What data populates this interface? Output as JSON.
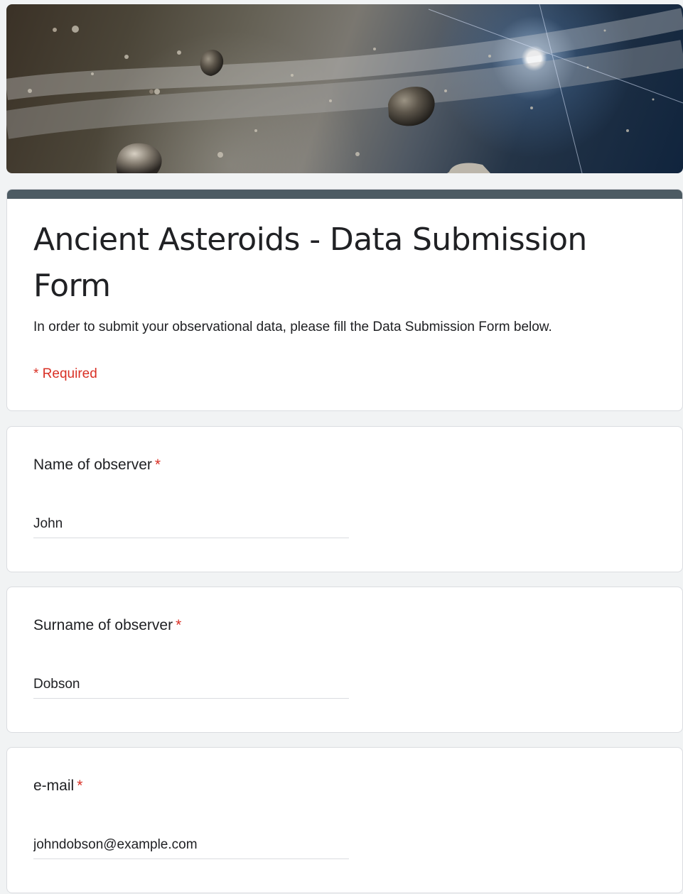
{
  "banner": {
    "image_name": "asteroids-banner-image"
  },
  "form": {
    "title": "Ancient Asteroids - Data Submission Form",
    "description": "In order to submit your observational data, please fill the Data Submission Form below.",
    "required_note": "* Required",
    "accent_color": "#4d5b63",
    "required_color": "#d93025"
  },
  "questions": [
    {
      "label": "Name of observer",
      "required_mark": "*",
      "value": "John"
    },
    {
      "label": "Surname of observer",
      "required_mark": "*",
      "value": "Dobson"
    },
    {
      "label": "e-mail",
      "required_mark": "*",
      "value": "johndobson@example.com"
    }
  ]
}
